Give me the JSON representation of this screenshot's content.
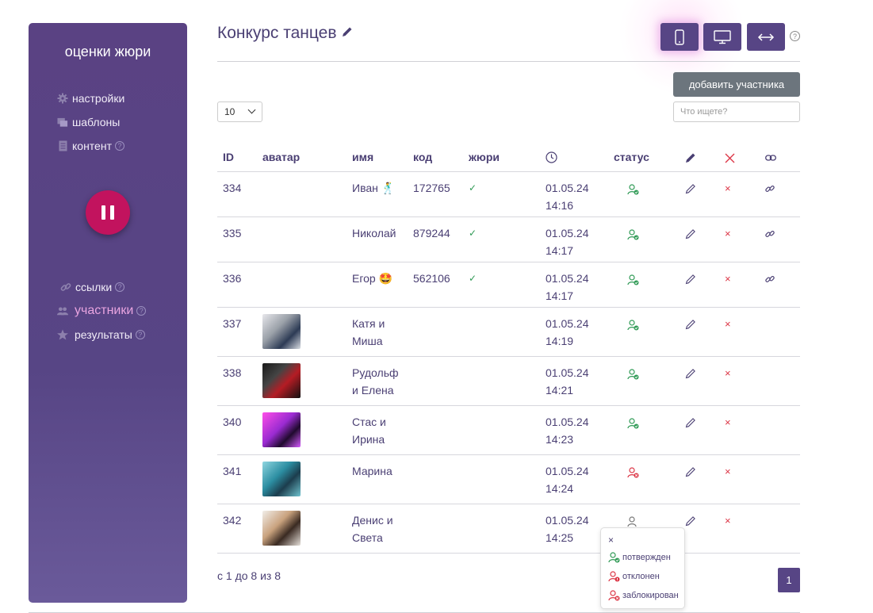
{
  "sidebar": {
    "title": "оценки жюри",
    "menu_top": [
      {
        "label": "настройки",
        "icon": "gear-icon"
      },
      {
        "label": "шаблоны",
        "icon": "templates-icon"
      },
      {
        "label": "контент",
        "icon": "document-icon"
      }
    ],
    "menu_bottom": [
      {
        "label": "ссылки",
        "icon": "link-icon"
      },
      {
        "label": "участники",
        "icon": "users-icon",
        "active": true
      },
      {
        "label": "результаты",
        "icon": "star-icon"
      }
    ],
    "help_glyph": "?"
  },
  "header": {
    "title": "Конкурс танцев",
    "view_buttons": [
      "phone-view",
      "desktop-view",
      "fit-width"
    ],
    "help_glyph": "?"
  },
  "toolbar": {
    "add_label": "добавить участника",
    "page_size": "10",
    "search_placeholder": "Что ищете?"
  },
  "table": {
    "headers": {
      "id": "ID",
      "avatar": "аватар",
      "name": "имя",
      "code": "код",
      "jury": "жюри"
    },
    "rows": [
      {
        "id": "334",
        "name": "Иван 🕺",
        "name2": "",
        "code": "172765",
        "jury": "✓",
        "date": "01.05.24",
        "time": "14:16",
        "status": "confirmed",
        "link": true
      },
      {
        "id": "335",
        "name": "Николай",
        "name2": "",
        "code": "879244",
        "jury": "✓",
        "date": "01.05.24",
        "time": "14:17",
        "status": "confirmed",
        "link": true
      },
      {
        "id": "336",
        "name": "Егор 🤩",
        "name2": "",
        "code": "562106",
        "jury": "✓",
        "date": "01.05.24",
        "time": "14:17",
        "status": "confirmed",
        "link": true
      },
      {
        "id": "337",
        "name": "Катя и",
        "name2": "Миша",
        "code": "",
        "jury": "",
        "date": "01.05.24",
        "time": "14:19",
        "status": "confirmed",
        "link": false
      },
      {
        "id": "338",
        "name": "Рудольф",
        "name2": "и Елена",
        "code": "",
        "jury": "",
        "date": "01.05.24",
        "time": "14:21",
        "status": "confirmed",
        "link": false
      },
      {
        "id": "340",
        "name": "Стас и",
        "name2": "Ирина",
        "code": "",
        "jury": "",
        "date": "01.05.24",
        "time": "14:23",
        "status": "confirmed",
        "link": false
      },
      {
        "id": "341",
        "name": "Марина",
        "name2": "",
        "code": "",
        "jury": "",
        "date": "01.05.24",
        "time": "14:24",
        "status": "blocked",
        "link": false
      },
      {
        "id": "342",
        "name": "Денис и",
        "name2": "Света",
        "code": "",
        "jury": "",
        "date": "01.05.24",
        "time": "14:25",
        "status": "none",
        "link": false
      }
    ],
    "status_header": "статус",
    "delete_glyph": "×"
  },
  "pager": {
    "info": "с 1 до 8 из 8",
    "current_page": "1"
  },
  "status_popup": {
    "close": "×",
    "options": [
      "потвержден",
      "отклонен",
      "заблокирован"
    ]
  },
  "colors": {
    "accent": "#574585",
    "pause": "#c2135e",
    "confirmed": "#2f9a55",
    "danger": "#dc3545"
  }
}
